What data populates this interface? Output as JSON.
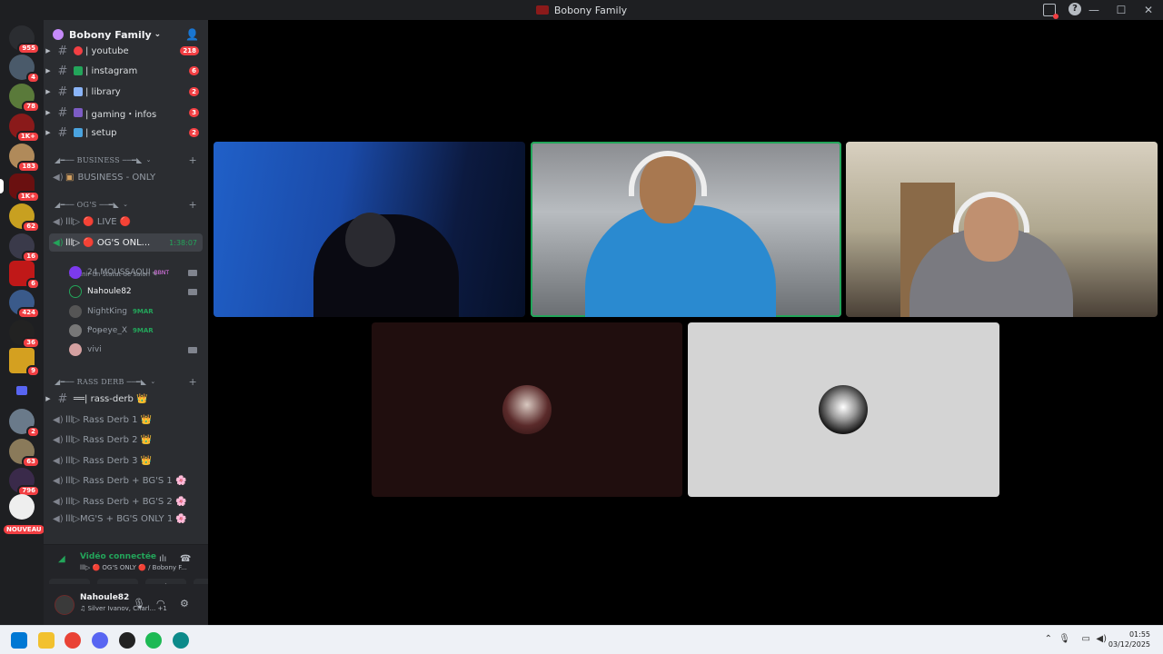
{
  "window": {
    "title": "Bobony Family"
  },
  "server": {
    "name": "Bobony Family"
  },
  "guild_badges": [
    "955",
    "4",
    "78",
    "1K+",
    "183",
    "1K+",
    "62",
    "16",
    "6",
    "424",
    "36",
    "9",
    "2",
    "63",
    "796",
    "NOUVEAU"
  ],
  "text_channels": [
    {
      "name": "| youtube",
      "badge": "218",
      "emoji_color": "#f23f43"
    },
    {
      "name": "| instagram",
      "badge": "6",
      "emoji_color": "#23a55a"
    },
    {
      "name": "| library",
      "badge": "2",
      "emoji_color": "#5865f2"
    },
    {
      "name": "| gaming・infos",
      "badge": "3",
      "emoji_color": "#7c5cc4"
    },
    {
      "name": "| setup",
      "badge": "2",
      "emoji_color": "#4aa3df"
    }
  ],
  "categories": {
    "business": "◢━── BUSINESS ──━◣",
    "ogs": "◢━── OG'S ──━◣",
    "rass": "◢━── RASS DERB ──━◣"
  },
  "business_channel": "BUSINESS - ONLY",
  "og_live": "lll▷ 🔴 LIVE 🔴",
  "og_only": {
    "name": "lll▷ 🔴 OG'S ONL...",
    "timer": "1:38:07",
    "status": "Définir un statut de salon ✎"
  },
  "members": [
    {
      "name": "24 MOUSSAOUI",
      "tag": "BBNT",
      "color": "#7c3aed",
      "cam": true
    },
    {
      "name": "Nahoule82",
      "tag": "",
      "color": "#2a2a2a",
      "cam": true
    },
    {
      "name": "NightKing",
      "tag": "9MAR",
      "color": "#555",
      "cam": false
    },
    {
      "name": "Ᵽoᵽeye_X",
      "tag": "9MAR",
      "color": "#777",
      "cam": false
    },
    {
      "name": "vivi",
      "tag": "",
      "color": "#d4a0a0",
      "cam": true
    }
  ],
  "rass_channel": "══| rass-derb 👑",
  "rass_voice": [
    "lll▷ Rass Derb 1 👑",
    "lll▷ Rass Derb 2 👑",
    "lll▷ Rass Derb 3 👑",
    "lll▷ Rass Derb + BG'S 1 🌸",
    "lll▷ Rass Derb + BG'S 2 🌸",
    "lll▷MG'S + BG'S ONLY 1 🌸"
  ],
  "rtc": {
    "connected": "Vidéo connectée",
    "channel": "lll▷ 🔴 OG'S ONLY 🔴 / Bobony F..."
  },
  "user": {
    "name": "Nahoule82",
    "status": "♫ Silver Ivanov, Charl... +1"
  },
  "clock": {
    "time": "01:55",
    "date": "03/12/2025"
  },
  "icons": [
    "inbox-icon",
    "help-icon",
    "minimize-icon",
    "maximize-icon",
    "close-icon",
    "add-user-icon",
    "hash-icon",
    "speaker-icon",
    "camera-icon",
    "mic-icon",
    "headset-icon",
    "gear-icon",
    "hangup-icon"
  ]
}
